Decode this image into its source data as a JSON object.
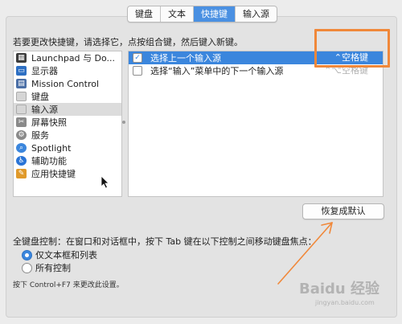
{
  "tabs": [
    {
      "label": "键盘",
      "active": false
    },
    {
      "label": "文本",
      "active": false
    },
    {
      "label": "快捷键",
      "active": true
    },
    {
      "label": "输入源",
      "active": false
    }
  ],
  "instruction": "若要更改快捷键，请选择它，点按组合键，然后键入新键。",
  "categories": [
    {
      "label": "Launchpad 与 Do...",
      "icon": "launchpad-icon",
      "icon_color": "#3d3d3d",
      "selected": false
    },
    {
      "label": "显示器",
      "icon": "display-icon",
      "icon_color": "#2d6fc3",
      "selected": false
    },
    {
      "label": "Mission Control",
      "icon": "mission-control-icon",
      "icon_color": "#4b6fa6",
      "selected": false
    },
    {
      "label": "键盘",
      "icon": "keyboard-icon",
      "icon_color": "#cfcfcf",
      "selected": false
    },
    {
      "label": "输入源",
      "icon": "input-source-icon",
      "icon_color": "#cfcfcf",
      "selected": true
    },
    {
      "label": "屏幕快照",
      "icon": "screenshot-icon",
      "icon_color": "#7a7a7a",
      "selected": false
    },
    {
      "label": "服务",
      "icon": "services-gear-icon",
      "icon_color": "#8a8a8a",
      "selected": false
    },
    {
      "label": "Spotlight",
      "icon": "spotlight-icon",
      "icon_color": "#3b86dd",
      "selected": false
    },
    {
      "label": "辅助功能",
      "icon": "accessibility-icon",
      "icon_color": "#2a74d6",
      "selected": false
    },
    {
      "label": "应用快捷键",
      "icon": "app-shortcuts-icon",
      "icon_color": "#e09a2b",
      "selected": false
    }
  ],
  "shortcuts": [
    {
      "label": "选择上一个输入源",
      "shortcut": "⌃空格键",
      "checked": true,
      "selected": true
    },
    {
      "label": "选择“输入”菜单中的下一个输入源",
      "shortcut": "⌃⌥空格键",
      "checked": false,
      "selected": false
    }
  ],
  "restore_defaults_label": "恢复成默认",
  "keyboard_control": {
    "title": "全键盘控制：在窗口和对话框中，按下 Tab 键在以下控制之间移动键盘焦点：",
    "options": [
      {
        "label": "仅文本框和列表",
        "selected": true
      },
      {
        "label": "所有控制",
        "selected": false
      }
    ],
    "hint": "按下 Control+F7 来更改此设置。"
  },
  "watermark": {
    "main": "Baidu 经验",
    "sub": "jingyan.baidu.com"
  },
  "colors": {
    "accent": "#3b86dd",
    "annotation": "#f0883a"
  }
}
